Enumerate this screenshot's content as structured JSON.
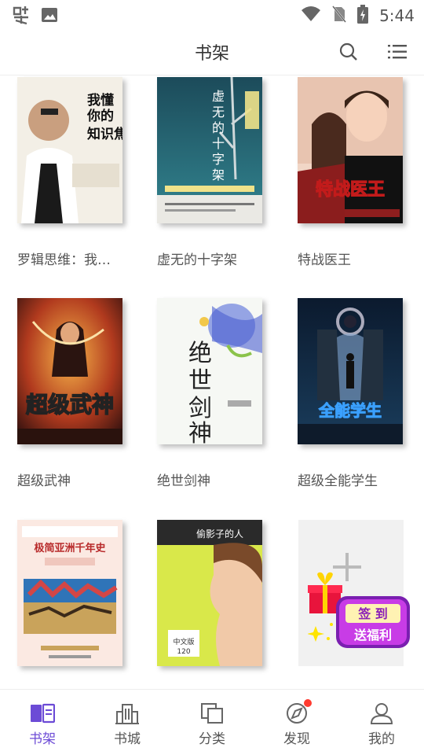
{
  "status_bar": {
    "time": "5:44"
  },
  "header": {
    "title": "书架"
  },
  "books": [
    {
      "title": "罗辑思维：我…",
      "cover_text": "我懂你的知识焦虑"
    },
    {
      "title": "虚无的十字架",
      "cover_text": "虚无的十字架"
    },
    {
      "title": "特战医王",
      "cover_text": "特战医王"
    },
    {
      "title": "超级武神",
      "cover_text": "超级武神"
    },
    {
      "title": "绝世剑神",
      "cover_text": "绝世剑神"
    },
    {
      "title": "超级全能学生",
      "cover_text": "全能学生"
    },
    {
      "title": "",
      "cover_text": "极简亚洲千年史"
    },
    {
      "title": "",
      "cover_text": "偷影子的人"
    }
  ],
  "add_book": {
    "label": "添加"
  },
  "sign_badge": {
    "line1": "签  到",
    "line2": "送福利"
  },
  "nav": [
    {
      "label": "书架",
      "active": true
    },
    {
      "label": "书城"
    },
    {
      "label": "分类"
    },
    {
      "label": "发现"
    },
    {
      "label": "我的"
    }
  ],
  "colors": {
    "accent": "#6c4bd6",
    "badge": "#ff3b30"
  }
}
